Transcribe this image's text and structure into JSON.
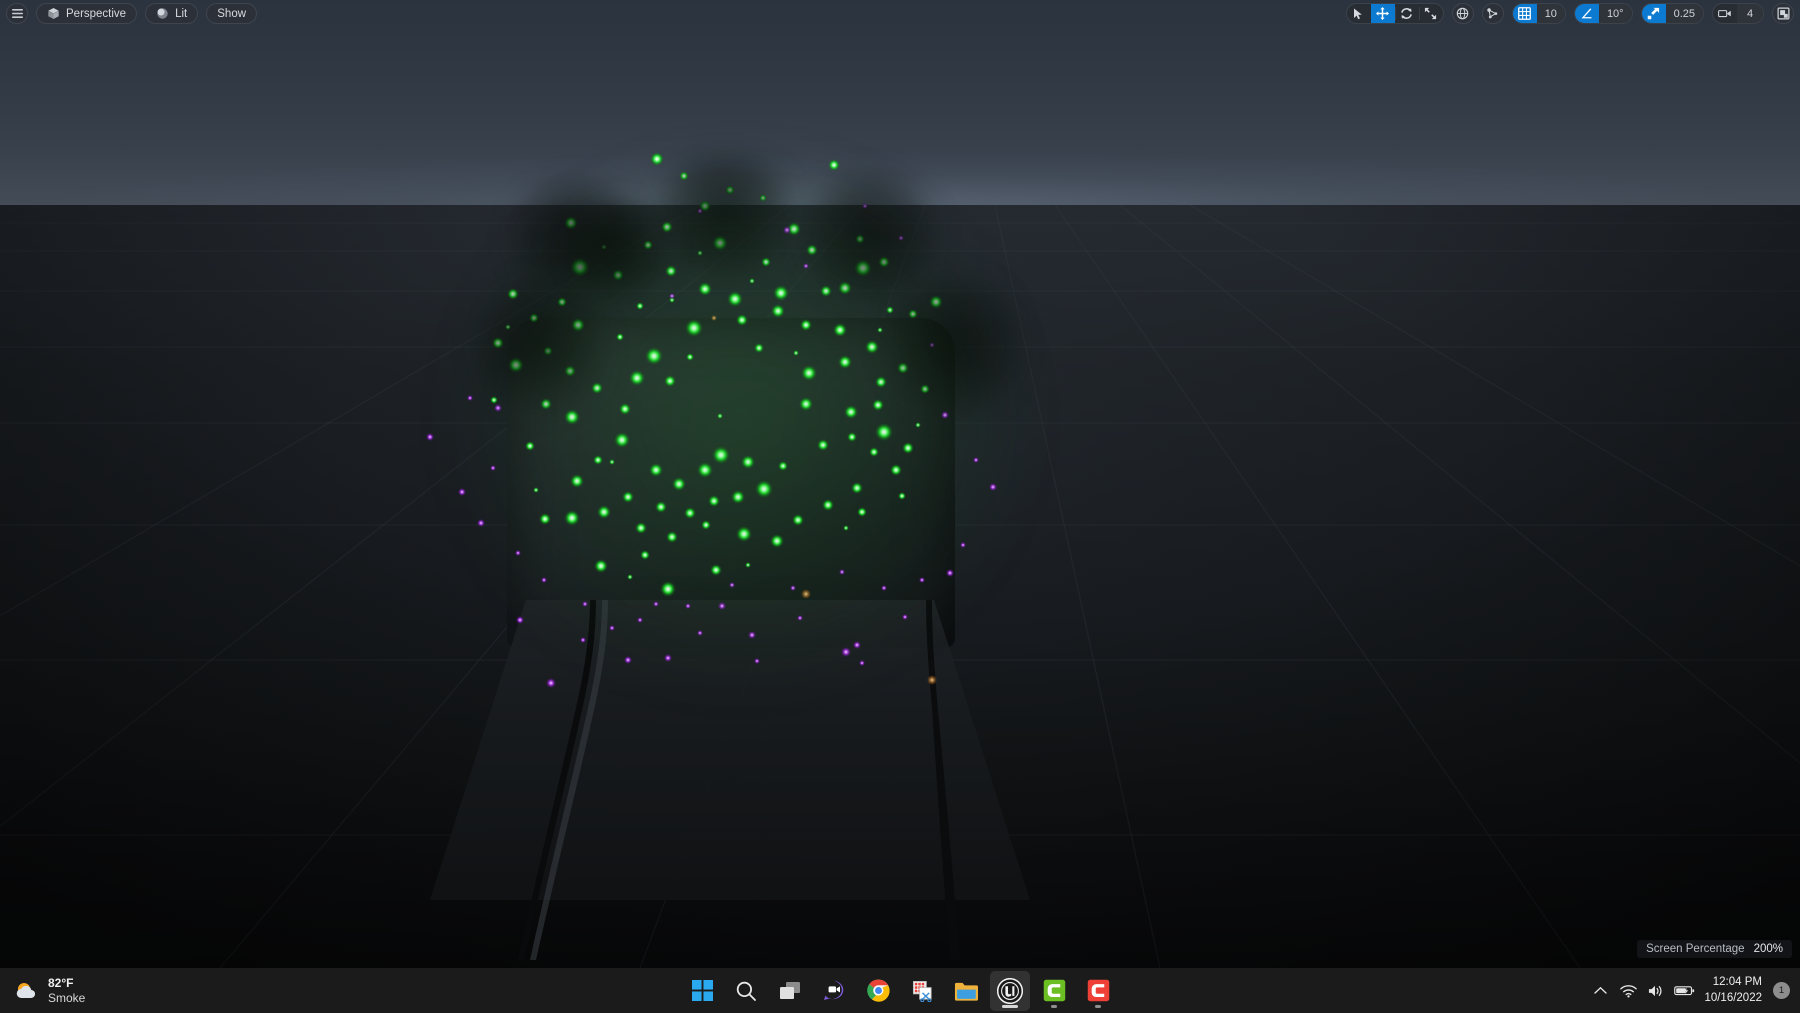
{
  "app": {
    "name": "Unreal Engine Editor Viewport"
  },
  "viewport": {
    "menu_icon": "hamburger-menu-icon",
    "view_mode_button": {
      "label": "Perspective",
      "icon": "cube-icon"
    },
    "lighting_button": {
      "label": "Lit",
      "icon": "sphere-icon"
    },
    "show_button": {
      "label": "Show"
    },
    "transform_tools": [
      {
        "name": "select",
        "icon": "cursor-arrow-icon",
        "active": false
      },
      {
        "name": "translate",
        "icon": "move-arrows-icon",
        "active": true
      },
      {
        "name": "rotate",
        "icon": "rotate-arrows-icon",
        "active": false
      },
      {
        "name": "scale",
        "icon": "scale-arrows-icon",
        "active": false
      }
    ],
    "coordinate_system": {
      "name": "world-space",
      "icon": "globe-icon",
      "active": false
    },
    "surface_snap": {
      "name": "surface-snapping",
      "icon": "vertex-snap-icon",
      "active": false
    },
    "grid_snap": {
      "icon": "grid-icon",
      "active": true,
      "value": "10"
    },
    "angle_snap": {
      "icon": "angle-icon",
      "active": true,
      "value": "10°"
    },
    "scale_snap": {
      "icon": "scale-snap-icon",
      "active": true,
      "value": "0.25"
    },
    "camera_speed": {
      "icon": "camera-icon",
      "active": false,
      "value": "4"
    },
    "maximize": {
      "icon": "maximize-viewport-icon",
      "active": false
    },
    "stats": {
      "label": "Screen Percentage",
      "value": "200%"
    }
  },
  "taskbar": {
    "weather": {
      "temperature": "82°F",
      "condition": "Smoke",
      "icon": "sun-cloud-icon"
    },
    "apps": [
      {
        "name": "start-button",
        "icon": "windows-logo-icon",
        "active": false,
        "running": false
      },
      {
        "name": "search",
        "icon": "search-icon",
        "active": false,
        "running": false
      },
      {
        "name": "task-view",
        "icon": "task-view-icon",
        "active": false,
        "running": false
      },
      {
        "name": "chat",
        "icon": "chat-video-icon",
        "active": false,
        "running": false
      },
      {
        "name": "google-chrome",
        "icon": "chrome-icon",
        "active": false,
        "running": false
      },
      {
        "name": "snipping-tool",
        "icon": "snipping-tool-icon",
        "active": false,
        "running": false
      },
      {
        "name": "file-explorer",
        "icon": "folder-icon",
        "active": false,
        "running": false
      },
      {
        "name": "unreal-engine",
        "icon": "unreal-engine-icon",
        "active": true,
        "running": true
      },
      {
        "name": "clion",
        "icon": "green-c-icon",
        "active": false,
        "running": true
      },
      {
        "name": "capcut",
        "icon": "red-c-icon",
        "active": false,
        "running": true
      }
    ],
    "tray": [
      {
        "name": "show-hidden-icons",
        "icon": "chevron-up-icon"
      },
      {
        "name": "network",
        "icon": "wifi-icon"
      },
      {
        "name": "volume",
        "icon": "speaker-icon"
      },
      {
        "name": "battery",
        "icon": "battery-charging-icon"
      }
    ],
    "clock": {
      "time": "12:04 PM",
      "date": "10/16/2022"
    },
    "notifications": {
      "count": "1"
    }
  },
  "colors": {
    "accent_blue": "#0c7ad1",
    "particle_green": "#22ee33",
    "particle_purple": "#a02ce8",
    "sky_top": "#2b333f",
    "floor_dark": "#0a0b0c",
    "taskbar_bg": "#1b1b1b"
  },
  "scene": {
    "description": "Dark 3D level with ground plane and a chair mesh, green sparkle particle burst with purple embers falling"
  }
}
